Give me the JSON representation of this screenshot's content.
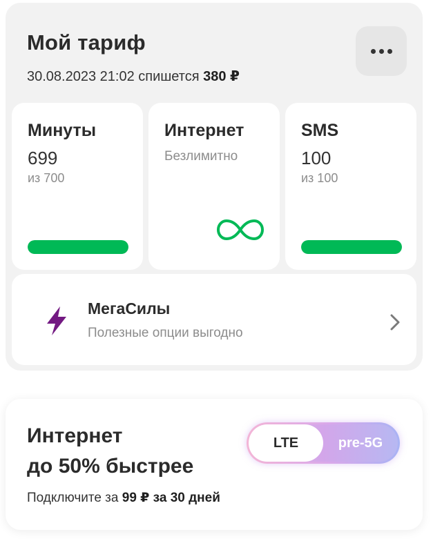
{
  "tariff": {
    "title": "Мой тариф",
    "charge_prefix": "30.08.2023 21:02 спишется",
    "charge_amount": "380 ₽",
    "more_label": "ещё"
  },
  "tiles": {
    "minutes": {
      "title": "Минуты",
      "value": "699",
      "note": "из 700",
      "fraction_remaining": 0.9986
    },
    "internet": {
      "title": "Интернет",
      "note": "Безлимитно",
      "icon": "infinity-icon"
    },
    "sms": {
      "title": "SMS",
      "value": "100",
      "note": "из 100",
      "fraction_remaining": 1.0
    }
  },
  "mega": {
    "title": "МегаСилы",
    "subtitle": "Полезные опции выгодно",
    "icon": "lightning-icon"
  },
  "promo": {
    "title_line1": "Интернет",
    "title_line2": "до 50% быстрее",
    "sub_prefix": "Подключите за",
    "sub_bold": "99 ₽ за 30 дней",
    "toggle_left": "LTE",
    "toggle_right": "pre-5G"
  },
  "colors": {
    "accent_green": "#00b956",
    "mega_purple": "#731982",
    "card_bg": "#f2f2f2"
  }
}
